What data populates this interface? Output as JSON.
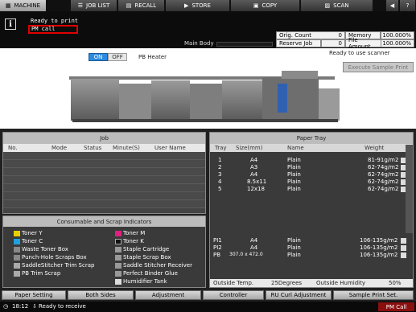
{
  "tabs": [
    {
      "label": "MACHINE",
      "icon": "machine-icon",
      "active": true
    },
    {
      "label": "JOB LIST",
      "icon": "list-icon",
      "active": false
    },
    {
      "label": "RECALL",
      "icon": "recall-icon",
      "active": false
    },
    {
      "label": "STORE",
      "icon": "store-icon",
      "active": false
    },
    {
      "label": "COPY",
      "icon": "copy-icon",
      "active": false
    },
    {
      "label": "SCAN",
      "icon": "scan-icon",
      "active": false
    }
  ],
  "message": {
    "line1": "Ready to print",
    "line2": "PM call"
  },
  "main_body_label": "Main Body",
  "counters": {
    "orig_count_label": "Orig. Count",
    "orig_count_value": "0",
    "reserve_job_label": "Reserve Job",
    "reserve_job_value": "0",
    "memory_label": "Memory",
    "memory_value": "100.000%",
    "file_amount_label": "File Amount",
    "file_amount_value": "100.000%"
  },
  "scanner_status": "Ready to use scanner",
  "pb_heater": {
    "on_label": "ON",
    "off_label": "OFF",
    "label": "PB Heater",
    "state": "ON"
  },
  "exec_sample_label": "Execute Sample Print",
  "job_panel": {
    "title": "Job",
    "columns": [
      "No.",
      "Mode",
      "Status",
      "Minute(S)",
      "User Name"
    ]
  },
  "consumables": {
    "title": "Consumable and Scrap Indicators",
    "left": [
      "Toner Y",
      "Toner C",
      "Waste Toner Box",
      "Punch-Hole Scraps Box",
      "SaddleStitcher Trim Scrap",
      "PB Trim Scrap"
    ],
    "right": [
      "Toner M",
      "Toner K",
      "Staple Cartridge",
      "Staple Scrap Box",
      "Saddle Stitcher Receiver",
      "Perfect Binder Glue",
      "Humidifier Tank"
    ]
  },
  "paper_tray": {
    "title": "Paper Tray",
    "columns": [
      "Tray",
      "Size(mm)",
      "Name",
      "Weight"
    ],
    "rows": [
      {
        "tray": "1",
        "size": "A4",
        "name": "Plain",
        "weight": "81-91g/m2"
      },
      {
        "tray": "2",
        "size": "A3",
        "name": "Plain",
        "weight": "62-74g/m2"
      },
      {
        "tray": "3",
        "size": "A4",
        "name": "Plain",
        "weight": "62-74g/m2"
      },
      {
        "tray": "4",
        "size": "8.5x11",
        "name": "Plain",
        "weight": "62-74g/m2"
      },
      {
        "tray": "5",
        "size": "12x18",
        "name": "Plain",
        "weight": "62-74g/m2"
      }
    ],
    "pi_rows": [
      {
        "tray": "PI1",
        "size": "A4",
        "name": "Plain",
        "weight": "106-135g/m2"
      },
      {
        "tray": "PI2",
        "size": "A4",
        "name": "Plain",
        "weight": "106-135g/m2"
      },
      {
        "tray": "PB",
        "size": "307.0 x 472.0",
        "name": "Plain",
        "weight": "106-135g/m2"
      }
    ],
    "outside_temp_label": "Outside Temp.",
    "outside_temp_value": "25Degrees",
    "outside_humidity_label": "Outside Humidity",
    "outside_humidity_value": "50%"
  },
  "bottom_buttons": [
    "Paper Setting",
    "Both Sides",
    "Adjustment",
    "Controller",
    "RU Curl Adjustment",
    "Sample Print Set."
  ],
  "status": {
    "time": "18:12",
    "message": "Ready to receive",
    "pm": "PM Call"
  }
}
